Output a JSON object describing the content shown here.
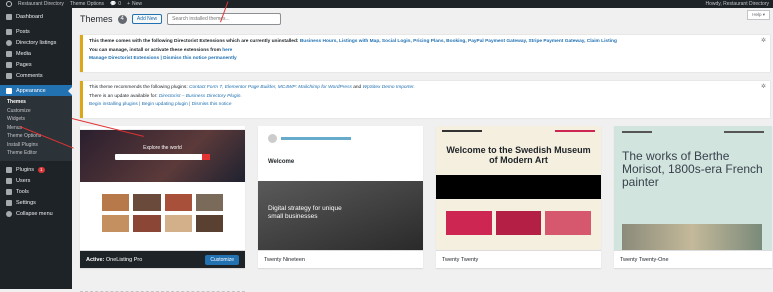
{
  "adminbar": {
    "site": "Restaurant Directory",
    "theme_options": "Theme Options",
    "comments": "0",
    "new": "New",
    "howdy": "Howdy, Restaurant Directory"
  },
  "sidebar": {
    "items": [
      {
        "label": "Dashboard",
        "icon": "dashboard-icon"
      },
      {
        "label": "Posts",
        "icon": "pin-icon"
      },
      {
        "label": "Directory listings",
        "icon": "listing-icon"
      },
      {
        "label": "Media",
        "icon": "media-icon"
      },
      {
        "label": "Pages",
        "icon": "page-icon"
      },
      {
        "label": "Comments",
        "icon": "comment-icon"
      },
      {
        "label": "Appearance",
        "icon": "brush-icon"
      }
    ],
    "submenu": [
      "Themes",
      "Customize",
      "Widgets",
      "Menus",
      "Theme Options",
      "Install Plugins",
      "Theme Editor"
    ],
    "bottom": [
      {
        "label": "Plugins",
        "icon": "plugin-icon",
        "badge": "1"
      },
      {
        "label": "Users",
        "icon": "users-icon"
      },
      {
        "label": "Tools",
        "icon": "tools-icon"
      },
      {
        "label": "Settings",
        "icon": "settings-icon"
      },
      {
        "label": "Collapse menu",
        "icon": "collapse-icon"
      }
    ]
  },
  "header": {
    "title": "Themes",
    "count": "4",
    "add_new": "Add New",
    "search_placeholder": "Search installed themes...",
    "help": "Help ▾"
  },
  "notice1": {
    "line1_lead": "This theme comes with the following Directorist Extensions which are currently uninstalled: ",
    "line1_list": "Business Hours, Listings with Map, Social Login, Pricing Plans, Booking, PayPal Payment Gateway, Stripe Payment Gateway, Claim Listing",
    "line2_lead": "You can manage, install or activate these extensions from ",
    "line2_link": "here",
    "line3": "Manage Directorist Extensions | Dismiss this notice permanently"
  },
  "notice2": {
    "line1_lead": "This theme recommends the following plugins: ",
    "line1_list": "Contact Form 7, Elementor Page Builder, MC4WP: Mailchimp for WordPress",
    "line1_and": " and ",
    "line1_last": "WpSitex Demo Importer.",
    "line2_lead": "There is an update available for: ",
    "line2_link": "Directorist – Business Directory Plugin.",
    "line3": "Begin installing plugins | Begin updating plugin | Dismiss this notice"
  },
  "themes": [
    {
      "name": "OneListing Pro",
      "active_prefix": "Active:",
      "action": "Customize",
      "hero": "Explore the world"
    },
    {
      "name": "Twenty Nineteen",
      "hero": "Welcome",
      "sub": "Digital strategy for unique small businesses"
    },
    {
      "name": "Twenty Twenty",
      "hero": "Welcome to the Swedish Museum of Modern Art"
    },
    {
      "name": "Twenty Twenty-One",
      "hero": "The works of Berthe Morisot, 1800s-era French painter"
    }
  ],
  "colors": {
    "accent": "#2271b1",
    "sidebar": "#1d2327",
    "notice": "#dba617",
    "annotation": "#e23232"
  }
}
